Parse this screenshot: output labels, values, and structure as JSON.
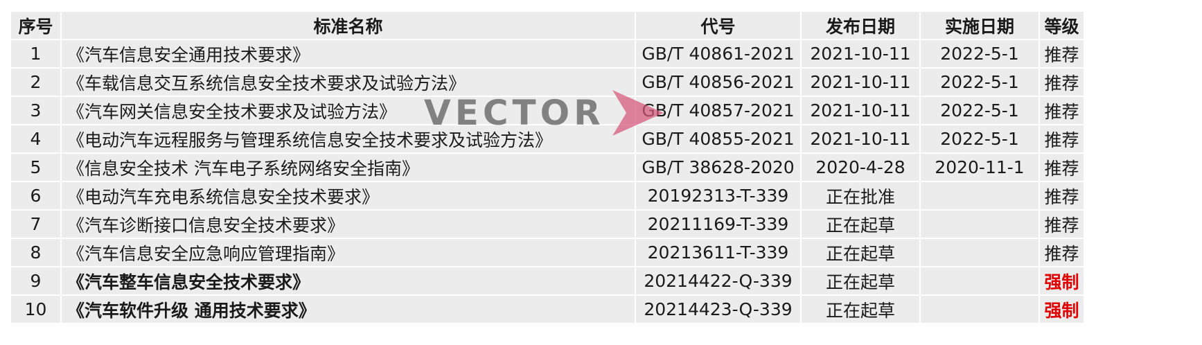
{
  "table": {
    "headers": [
      "序号",
      "标准名称",
      "代号",
      "发布日期",
      "实施日期",
      "等级"
    ],
    "rows": [
      {
        "idx": "1",
        "name": "《汽车信息安全通用技术要求》",
        "code": "GB/T 40861-2021",
        "published": "2021-10-11",
        "implemented": "2022-5-1",
        "level": "推荐"
      },
      {
        "idx": "2",
        "name": "《车载信息交互系统信息安全技术要求及试验方法》",
        "code": "GB/T 40856-2021",
        "published": "2021-10-11",
        "implemented": "2022-5-1",
        "level": "推荐"
      },
      {
        "idx": "3",
        "name": "《汽车网关信息安全技术要求及试验方法》",
        "code": "GB/T 40857-2021",
        "published": "2021-10-11",
        "implemented": "2022-5-1",
        "level": "推荐"
      },
      {
        "idx": "4",
        "name": "《电动汽车远程服务与管理系统信息安全技术要求及试验方法》",
        "code": "GB/T 40855-2021",
        "published": "2021-10-11",
        "implemented": "2022-5-1",
        "level": "推荐"
      },
      {
        "idx": "5",
        "name": "《信息安全技术 汽车电子系统网络安全指南》",
        "code": "GB/T 38628-2020",
        "published": "2020-4-28",
        "implemented": "2020-11-1",
        "level": "推荐"
      },
      {
        "idx": "6",
        "name": "《电动汽车充电系统信息安全技术要求》",
        "code": "20192313-T-339",
        "published": "正在批准",
        "implemented": "",
        "level": "推荐"
      },
      {
        "idx": "7",
        "name": "《汽车诊断接口信息安全技术要求》",
        "code": "20211169-T-339",
        "published": "正在起草",
        "implemented": "",
        "level": "推荐"
      },
      {
        "idx": "8",
        "name": "《汽车信息安全应急响应管理指南》",
        "code": "20213611-T-339",
        "published": "正在起草",
        "implemented": "",
        "level": "推荐"
      },
      {
        "idx": "9",
        "name": "《汽车整车信息安全技术要求》",
        "code": "20214422-Q-339",
        "published": "正在起草",
        "implemented": "",
        "level": "强制"
      },
      {
        "idx": "10",
        "name": "《汽车软件升级 通用技术要求》",
        "code": "20214423-Q-339",
        "published": "正在起草",
        "implemented": "",
        "level": "强制"
      }
    ]
  },
  "watermark": {
    "text": "VECTOR",
    "text_color": "#595959",
    "arrow_color": "#d6577a"
  },
  "colors": {
    "cell_bg": "#ececec",
    "mandatory": "#e00000"
  }
}
